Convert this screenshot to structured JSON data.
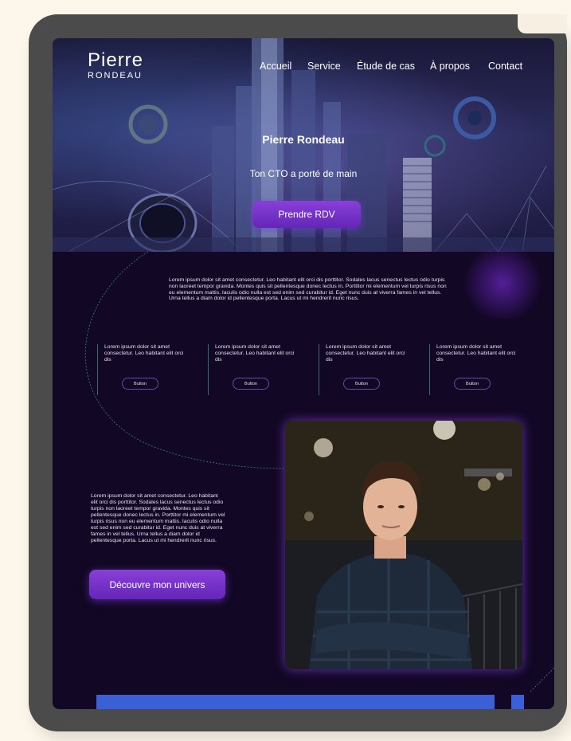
{
  "brand": {
    "first": "Pierre",
    "last": "RONDEAU"
  },
  "nav": [
    "Accueil",
    "Service",
    "Étude de cas",
    "À propos",
    "Contact"
  ],
  "hero": {
    "title": "Pierre Rondeau",
    "subtitle": "Ton CTO a porté de main",
    "cta": "Prendre RDV"
  },
  "intro": "Lorem ipsum dolor sit amet consectetur. Leo habitant elit orci dis porttitor. Sodales lacus senectus lectus odio turpis non laoreet tempor gravida. Montes quis sit pellentesque donec lectus in. Porttitor mi elementum vel turpis risus non eu elementum mattis. Iaculis odio nulla est sed enim sed curabitur id. Eget nunc duis at viverra fames in vel tellus. Urna tellus a diam dolor id pellentesque porta. Lacus ut mi hendrerit nunc risus.",
  "features": [
    {
      "text": "Lorem ipsum dolor sit amet consectetur. Leo habitant elit orci dis",
      "button": "Button"
    },
    {
      "text": "Lorem ipsum dolor sit amet consectetur. Leo habitant elit orci dis",
      "button": "Button"
    },
    {
      "text": "Lorem ipsum dolor sit amet consectetur. Leo habitant elit orci dis",
      "button": "Button"
    },
    {
      "text": "Lorem ipsum dolor sit amet consectetur. Leo habitant elit orci dis",
      "button": "Button"
    }
  ],
  "about": {
    "text": "Lorem ipsum dolor sit amet consectetur. Leo habitant elit orci dis porttitor. Sodales lacus senectus lectus odio turpis non laoreet tempor gravida. Montes quis sit pellentesque donec lectus in. Porttitor mi elementum vel turpis risus non eu elementum mattis. Iaculis odio nulla est sed enim sed curabitur id. Eget nunc duis at viverra fames in vel tellus. Urna tellus a diam dolor id pellentesque porta. Lacus ut mi hendrerit nunc risus.",
    "cta": "Découvre mon univers"
  },
  "colors": {
    "page_bg": "#fdf6ea",
    "tablet": "#4b4b4b",
    "screen_bg": "#120724",
    "accent": "#7a34cf",
    "bottom_bar": "#3a5fd6"
  }
}
